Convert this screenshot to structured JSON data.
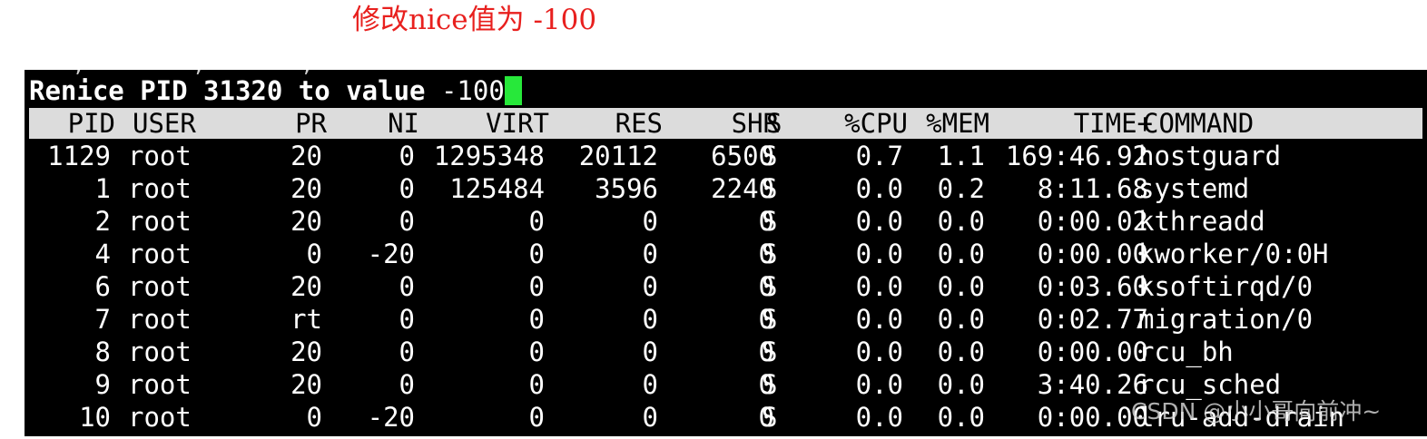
{
  "annotation": "修改nice值为 -100",
  "terminal": {
    "scroll_remnant": "    ,         ,        ,",
    "prompt": {
      "label": "Renice PID 31320 to value",
      "value": " -100"
    },
    "columns": {
      "pid": "PID",
      "user": "USER",
      "pr": "PR",
      "ni": "NI",
      "virt": "VIRT",
      "res": "RES",
      "shr": "SHR",
      "s": "S",
      "cpu": "%CPU",
      "mem": "%MEM",
      "time": "TIME+",
      "command": "COMMAND"
    },
    "processes": [
      {
        "pid": "1129",
        "user": "root",
        "pr": "20",
        "ni": "0",
        "virt": "1295348",
        "res": "20112",
        "shr": "6500",
        "s": "S",
        "cpu": "0.7",
        "mem": "1.1",
        "time": "169:46.92",
        "command": "hostguard"
      },
      {
        "pid": "1",
        "user": "root",
        "pr": "20",
        "ni": "0",
        "virt": "125484",
        "res": "3596",
        "shr": "2240",
        "s": "S",
        "cpu": "0.0",
        "mem": "0.2",
        "time": "8:11.68",
        "command": "systemd"
      },
      {
        "pid": "2",
        "user": "root",
        "pr": "20",
        "ni": "0",
        "virt": "0",
        "res": "0",
        "shr": "0",
        "s": "S",
        "cpu": "0.0",
        "mem": "0.0",
        "time": "0:00.02",
        "command": "kthreadd"
      },
      {
        "pid": "4",
        "user": "root",
        "pr": "0",
        "ni": "-20",
        "virt": "0",
        "res": "0",
        "shr": "0",
        "s": "S",
        "cpu": "0.0",
        "mem": "0.0",
        "time": "0:00.00",
        "command": "kworker/0:0H"
      },
      {
        "pid": "6",
        "user": "root",
        "pr": "20",
        "ni": "0",
        "virt": "0",
        "res": "0",
        "shr": "0",
        "s": "S",
        "cpu": "0.0",
        "mem": "0.0",
        "time": "0:03.60",
        "command": "ksoftirqd/0"
      },
      {
        "pid": "7",
        "user": "root",
        "pr": "rt",
        "ni": "0",
        "virt": "0",
        "res": "0",
        "shr": "0",
        "s": "S",
        "cpu": "0.0",
        "mem": "0.0",
        "time": "0:02.77",
        "command": "migration/0"
      },
      {
        "pid": "8",
        "user": "root",
        "pr": "20",
        "ni": "0",
        "virt": "0",
        "res": "0",
        "shr": "0",
        "s": "S",
        "cpu": "0.0",
        "mem": "0.0",
        "time": "0:00.00",
        "command": "rcu_bh"
      },
      {
        "pid": "9",
        "user": "root",
        "pr": "20",
        "ni": "0",
        "virt": "0",
        "res": "0",
        "shr": "0",
        "s": "S",
        "cpu": "0.0",
        "mem": "0.0",
        "time": "3:40.26",
        "command": "rcu_sched"
      },
      {
        "pid": "10",
        "user": "root",
        "pr": "0",
        "ni": "-20",
        "virt": "0",
        "res": "0",
        "shr": "0",
        "s": "S",
        "cpu": "0.0",
        "mem": "0.0",
        "time": "0:00.00",
        "command": "lru-add-drain"
      }
    ]
  },
  "watermark": "CSDN @小小哥向前冲~",
  "colors": {
    "annotation": "#e8201e",
    "terminal_bg": "#000000",
    "terminal_fg": "#ffffff",
    "header_bg": "#dcdcdc",
    "cursor": "#27e83a"
  }
}
